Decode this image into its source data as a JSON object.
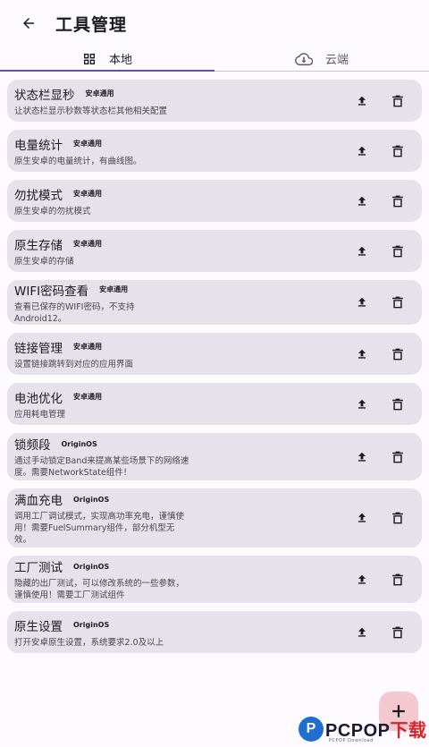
{
  "header": {
    "title": "工具管理"
  },
  "tabs": [
    {
      "label": "本地",
      "active": true
    },
    {
      "label": "云端",
      "active": false
    }
  ],
  "tools": [
    {
      "name": "状态栏显秒",
      "tag": "安卓通用",
      "desc": "让状态栏显示秒数等状态栏其他相关配置"
    },
    {
      "name": "电量统计",
      "tag": "安卓通用",
      "desc": "原生安卓的电量统计，有曲线图。"
    },
    {
      "name": "勿扰模式",
      "tag": "安卓通用",
      "desc": "原生安卓的勿扰模式"
    },
    {
      "name": "原生存储",
      "tag": "安卓通用",
      "desc": "原生安卓的存储"
    },
    {
      "name": "WIFI密码查看",
      "tag": "安卓通用",
      "desc": "查看已保存的WIFI密码，不支持Android12。"
    },
    {
      "name": "链接管理",
      "tag": "安卓通用",
      "desc": "设置链接跳转到对应的应用界面"
    },
    {
      "name": "电池优化",
      "tag": "安卓通用",
      "desc": "应用耗电管理"
    },
    {
      "name": "锁频段",
      "tag": "OriginOS",
      "desc": "通过手动锁定Band来提高某些场景下的网络速度。需要NetworkState组件！"
    },
    {
      "name": "满血充电",
      "tag": "OriginOS",
      "desc": "调用工厂调试模式，实现高功率充电，谨慎使用！需要FuelSummary组件，部分机型无效。"
    },
    {
      "name": "工厂测试",
      "tag": "OriginOS",
      "desc": "隐藏的出厂测试，可以修改系统的一些参数，谨慎使用！需要工厂测试组件"
    },
    {
      "name": "原生设置",
      "tag": "OriginOS",
      "desc": "打开安卓原生设置，系统要求2.0及以上"
    }
  ],
  "watermark": {
    "logo_letter": "P",
    "brand_blue": "PCPOP",
    "brand_red": "下载",
    "sub": "PCPOP Download"
  },
  "colors": {
    "accent": "#6750a4",
    "card": "#e7e1ec",
    "fab": "#f3c9cf"
  }
}
